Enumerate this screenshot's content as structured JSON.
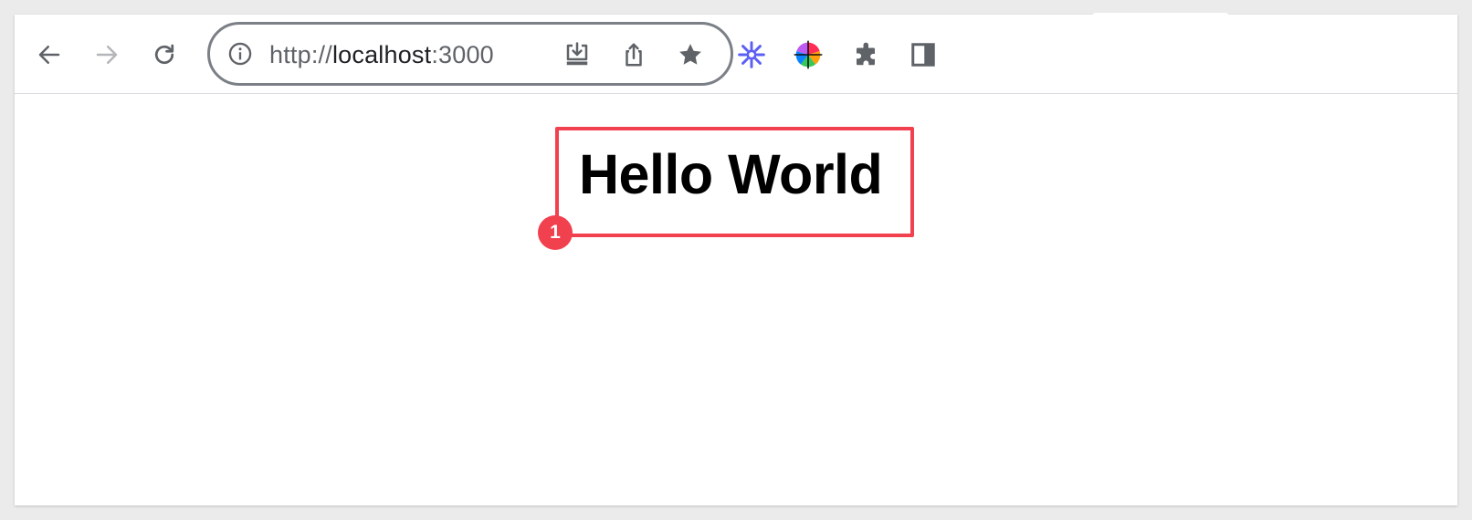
{
  "browser": {
    "url": {
      "scheme": "http://",
      "host": "localhost",
      "port": ":3000"
    },
    "toolbar": {
      "back_icon": "arrow-left-icon",
      "forward_icon": "arrow-right-icon",
      "reload_icon": "reload-icon",
      "site_info_icon": "info-icon",
      "install_icon": "install-app-icon",
      "share_icon": "share-icon",
      "bookmark_icon": "star-icon",
      "extensions": [
        "sparkle-extension-icon",
        "color-picker-extension-icon",
        "puzzle-extensions-icon"
      ],
      "side_panel_icon": "side-panel-icon"
    }
  },
  "page": {
    "heading": "Hello World"
  },
  "annotation": {
    "badge_label": "1",
    "color": "#f1414f"
  }
}
